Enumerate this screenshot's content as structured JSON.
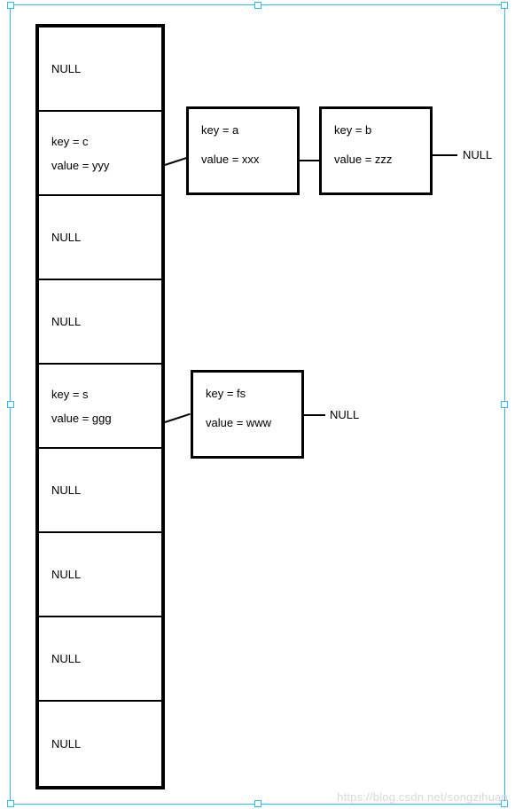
{
  "buckets": [
    {
      "type": "null",
      "label": "NULL"
    },
    {
      "type": "entry",
      "key_line": "key = c",
      "value_line": "value = yyy"
    },
    {
      "type": "null",
      "label": "NULL"
    },
    {
      "type": "null",
      "label": "NULL"
    },
    {
      "type": "entry",
      "key_line": "key = s",
      "value_line": "value = ggg"
    },
    {
      "type": "null",
      "label": "NULL"
    },
    {
      "type": "null",
      "label": "NULL"
    },
    {
      "type": "null",
      "label": "NULL"
    },
    {
      "type": "null",
      "label": "NULL"
    }
  ],
  "chains": {
    "row1": {
      "nodeA": {
        "key_line": "key  =  a",
        "value_line": "value  =  xxx"
      },
      "nodeB": {
        "key_line": "key = b",
        "value_line": "value = zzz"
      },
      "terminal": "NULL"
    },
    "row4": {
      "nodeA": {
        "key_line": "key = fs",
        "value_line": "value = www"
      },
      "terminal": "NULL"
    }
  },
  "watermark": "https://blog.csdn.net/songzihuan"
}
